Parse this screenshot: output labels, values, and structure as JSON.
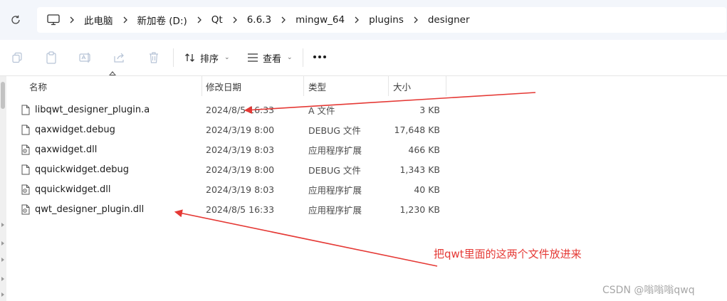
{
  "address_bar": {
    "crumbs": [
      "此电脑",
      "新加卷 (D:)",
      "Qt",
      "6.6.3",
      "mingw_64",
      "plugins",
      "designer"
    ],
    "pc_icon": "monitor-icon",
    "refresh_icon": "refresh-icon"
  },
  "toolbar": {
    "icons": [
      "copy-icon",
      "paste-icon",
      "rename-icon",
      "share-icon",
      "delete-icon"
    ],
    "sort_label": "排序",
    "view_label": "查看",
    "more_icon": "more-icon"
  },
  "columns": {
    "name": "名称",
    "date": "修改日期",
    "type": "类型",
    "size": "大小"
  },
  "files": [
    {
      "name": "libqwt_designer_plugin.a",
      "date": "2024/8/5 16:33",
      "type": "A 文件",
      "size": "3 KB",
      "icon": "file-icon"
    },
    {
      "name": "qaxwidget.debug",
      "date": "2024/3/19 8:00",
      "type": "DEBUG 文件",
      "size": "17,648 KB",
      "icon": "file-icon"
    },
    {
      "name": "qaxwidget.dll",
      "date": "2024/3/19 8:03",
      "type": "应用程序扩展",
      "size": "466 KB",
      "icon": "dll-file-icon"
    },
    {
      "name": "qquickwidget.debug",
      "date": "2024/3/19 8:00",
      "type": "DEBUG 文件",
      "size": "1,343 KB",
      "icon": "file-icon"
    },
    {
      "name": "qquickwidget.dll",
      "date": "2024/3/19 8:03",
      "type": "应用程序扩展",
      "size": "40 KB",
      "icon": "dll-file-icon"
    },
    {
      "name": "qwt_designer_plugin.dll",
      "date": "2024/8/5 16:33",
      "type": "应用程序扩展",
      "size": "1,230 KB",
      "icon": "dll-file-icon"
    }
  ],
  "annotation": {
    "note": "把qwt里面的这两个文件放进来",
    "color": "#e53935"
  },
  "watermark": "CSDN @嗡嗡嗡qwq"
}
